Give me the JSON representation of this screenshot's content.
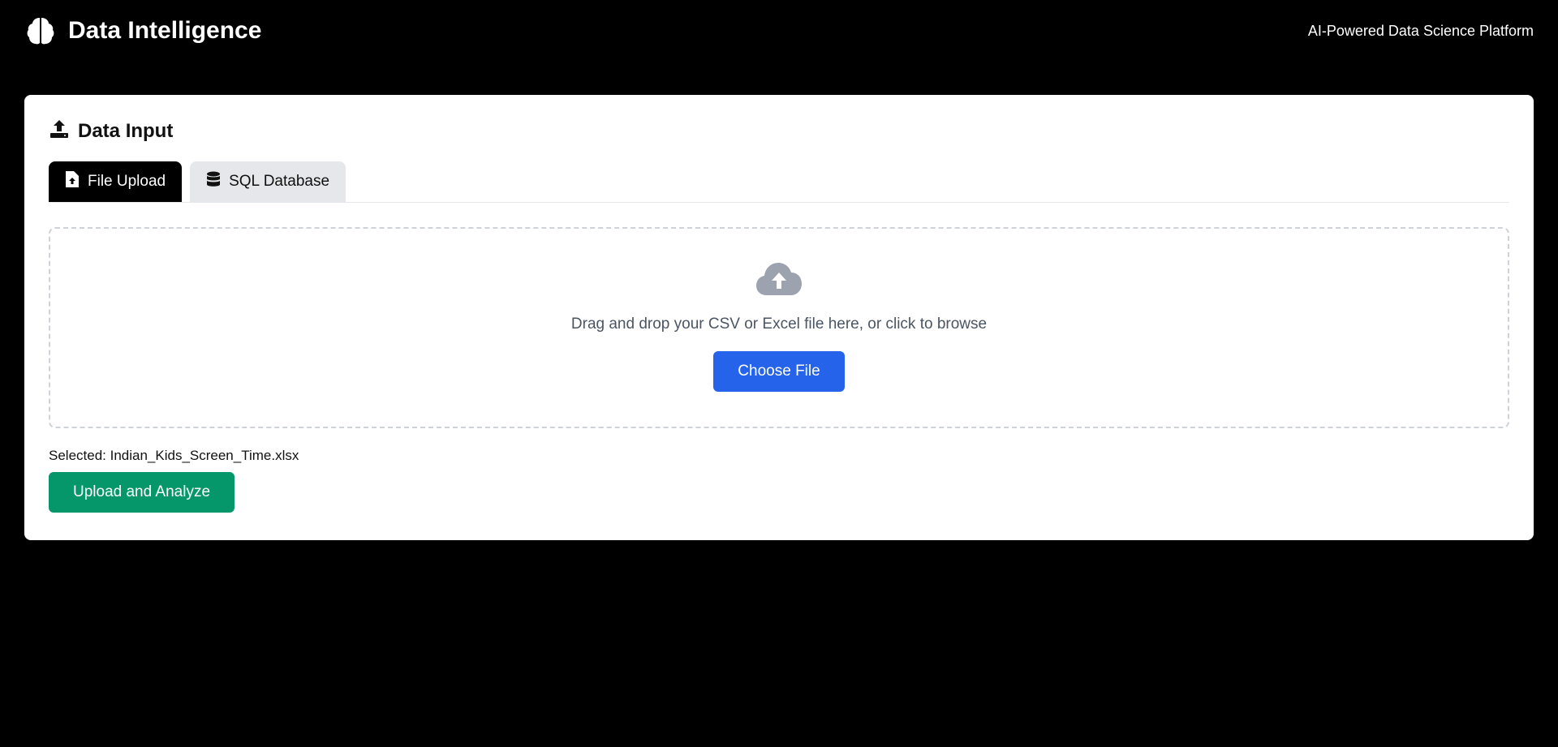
{
  "header": {
    "brand_icon": "brain-icon",
    "title": "Data Intelligence",
    "tagline": "AI-Powered Data Science Platform"
  },
  "card": {
    "title_icon": "upload-icon",
    "title": "Data Input",
    "tabs": [
      {
        "label": "File Upload",
        "icon": "file-upload-icon",
        "active": true
      },
      {
        "label": "SQL Database",
        "icon": "database-icon",
        "active": false
      }
    ],
    "dropzone": {
      "icon": "cloud-upload-icon",
      "text": "Drag and drop your CSV or Excel file here, or click to browse",
      "button_label": "Choose File"
    },
    "selected_text": "Selected: Indian_Kids_Screen_Time.xlsx",
    "upload_button_label": "Upload and Analyze"
  },
  "colors": {
    "background": "#000000",
    "active_tab": "#000000",
    "inactive_tab": "#e5e7eb",
    "choose_button": "#2563eb",
    "upload_button": "#059669",
    "dropzone_border": "#cfd2d6",
    "cloud_icon": "#9ca3af"
  }
}
